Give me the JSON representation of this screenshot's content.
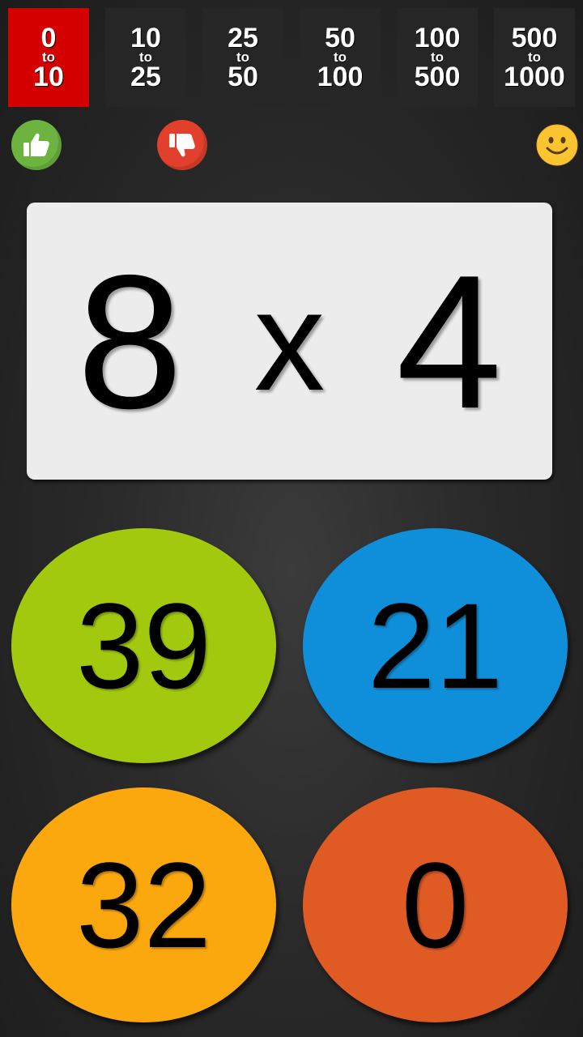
{
  "range_tabs": [
    {
      "from": "0",
      "to_word": "to",
      "to": "10",
      "active": true
    },
    {
      "from": "10",
      "to_word": "to",
      "to": "25",
      "active": false
    },
    {
      "from": "25",
      "to_word": "to",
      "to": "50",
      "active": false
    },
    {
      "from": "50",
      "to_word": "to",
      "to": "100",
      "active": false
    },
    {
      "from": "100",
      "to_word": "to",
      "to": "500",
      "active": false
    },
    {
      "from": "500",
      "to_word": "to",
      "to": "1000",
      "active": false
    }
  ],
  "icons": {
    "thumbs_up": "thumbs-up-icon",
    "thumbs_down": "thumbs-down-icon",
    "smiley": "smiley-icon"
  },
  "question": {
    "left": "8",
    "operator": "x",
    "right": "4"
  },
  "answers": [
    {
      "value": "39",
      "color": "#a3c90f"
    },
    {
      "value": "21",
      "color": "#0f8fd9"
    },
    {
      "value": "32",
      "color": "#fba80f"
    },
    {
      "value": "0",
      "color": "#e05a24"
    }
  ],
  "colors": {
    "active_tab": "#d40000",
    "inactive_tab": "#262626",
    "thumbs_up": "#6cb33f",
    "thumbs_down": "#e0402c",
    "smiley": "#fbc531"
  }
}
